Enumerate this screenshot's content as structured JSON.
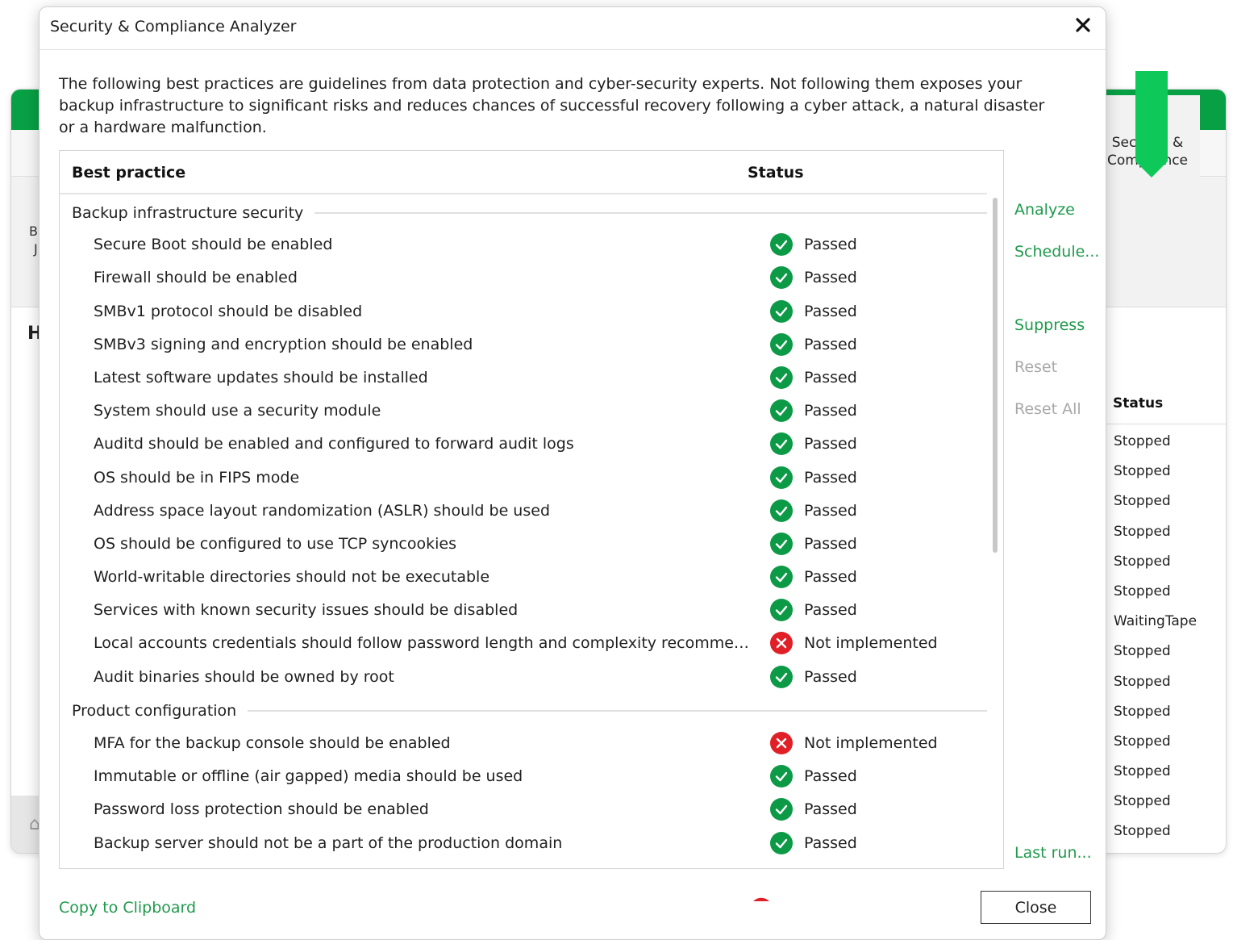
{
  "background": {
    "left_letters": [
      "B",
      "J"
    ],
    "heading_letter": "H",
    "tile": {
      "icon": "shield-check-icon",
      "label": "Security & Compliance"
    },
    "status_header": "Status",
    "statuses": [
      "Stopped",
      "Stopped",
      "Stopped",
      "Stopped",
      "Stopped",
      "Stopped",
      "WaitingTape",
      "Stopped",
      "Stopped",
      "Stopped",
      "Stopped",
      "Stopped",
      "Stopped",
      "Stopped"
    ]
  },
  "dialog": {
    "title": "Security & Compliance Analyzer",
    "close_icon": "close-icon",
    "intro": "The following best practices are guidelines from data protection and cyber-security experts. Not following them exposes your backup infrastructure to significant risks and reduces chances of successful recovery following a cyber attack, a natural disaster or a hardware malfunction.",
    "table": {
      "col_practice": "Best practice",
      "col_status": "Status",
      "groups": [
        {
          "name": "Backup infrastructure security",
          "items": [
            {
              "label": "Secure Boot should be enabled",
              "status": "Passed"
            },
            {
              "label": "Firewall should be enabled",
              "status": "Passed"
            },
            {
              "label": "SMBv1 protocol should be disabled",
              "status": "Passed"
            },
            {
              "label": "SMBv3 signing and encryption should be enabled",
              "status": "Passed"
            },
            {
              "label": "Latest software updates should be installed",
              "status": "Passed"
            },
            {
              "label": "System should use a security module",
              "status": "Passed"
            },
            {
              "label": "Auditd should be enabled and configured to forward audit logs",
              "status": "Passed"
            },
            {
              "label": "OS should be in FIPS mode",
              "status": "Passed"
            },
            {
              "label": "Address space layout randomization (ASLR) should be used",
              "status": "Passed"
            },
            {
              "label": "OS should be configured to use TCP syncookies",
              "status": "Passed"
            },
            {
              "label": "World-writable directories should not be executable",
              "status": "Passed"
            },
            {
              "label": "Services with known security issues should be disabled",
              "status": "Passed"
            },
            {
              "label": "Local accounts credentials should follow password length and complexity recommenda...",
              "status": "Not implemented"
            },
            {
              "label": "Audit binaries should be owned by root",
              "status": "Passed"
            }
          ]
        },
        {
          "name": "Product configuration",
          "items": [
            {
              "label": "MFA for the backup console should be enabled",
              "status": "Not implemented"
            },
            {
              "label": "Immutable or offline (air gapped) media should be used",
              "status": "Passed"
            },
            {
              "label": "Password loss protection should be enabled",
              "status": "Passed"
            },
            {
              "label": "Backup server should not be a part of the production domain",
              "status": "Passed"
            }
          ]
        }
      ]
    },
    "actions": {
      "analyze": "Analyze",
      "schedule": "Schedule...",
      "suppress": "Suppress",
      "reset": "Reset",
      "reset_all": "Reset All",
      "last_run": "Last run..."
    },
    "copy_to_clipboard": "Copy to Clipboard",
    "close_button": "Close"
  },
  "colors": {
    "accent_green": "#1e9a4b",
    "passed_green": "#0d9a47",
    "failed_red": "#e01f26",
    "brand_green": "#08a045"
  }
}
